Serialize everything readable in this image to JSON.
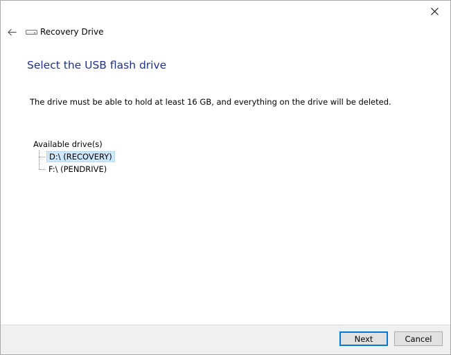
{
  "window": {
    "close_label": "Close"
  },
  "nav": {
    "back_label": "Back",
    "app_title": "Recovery Drive",
    "app_icon": "drive-icon"
  },
  "main": {
    "heading": "Select the USB flash drive",
    "description": "The drive must be able to hold at least 16 GB, and everything on the drive will be deleted."
  },
  "drives": {
    "root_label": "Available drive(s)",
    "items": [
      {
        "label": "D:\\ (RECOVERY)",
        "selected": true
      },
      {
        "label": "F:\\ (PENDRIVE)",
        "selected": false
      }
    ]
  },
  "footer": {
    "next_label": "Next",
    "cancel_label": "Cancel"
  },
  "colors": {
    "heading": "#1e3287",
    "selection": "#cce8ff",
    "default_button_border": "#0078d7",
    "footer_bg": "#f0f0f0"
  }
}
